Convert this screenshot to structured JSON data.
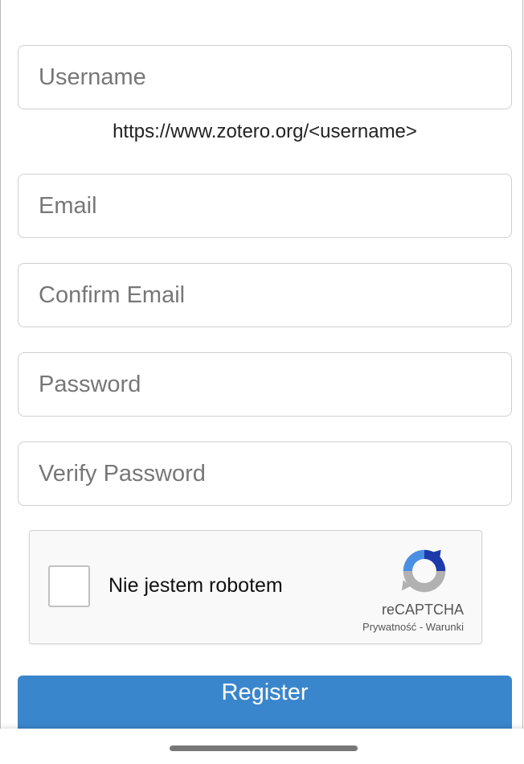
{
  "form": {
    "username_placeholder": "Username",
    "profile_url_hint": "https://www.zotero.org/<username>",
    "email_placeholder": "Email",
    "confirm_email_placeholder": "Confirm Email",
    "password_placeholder": "Password",
    "verify_password_placeholder": "Verify Password",
    "register_label": "Register"
  },
  "recaptcha": {
    "checkbox_label": "Nie jestem robotem",
    "brand": "reCAPTCHA",
    "privacy_link": "Prywatność",
    "separator": " - ",
    "terms_link": "Warunki",
    "icon": "recaptcha-logo-icon"
  },
  "colors": {
    "primary_button": "#3a86cc",
    "recaptcha_blue": "#4a90e2",
    "recaptcha_dark_blue": "#1c3aa9",
    "recaptcha_gray": "#b1b1b1"
  }
}
